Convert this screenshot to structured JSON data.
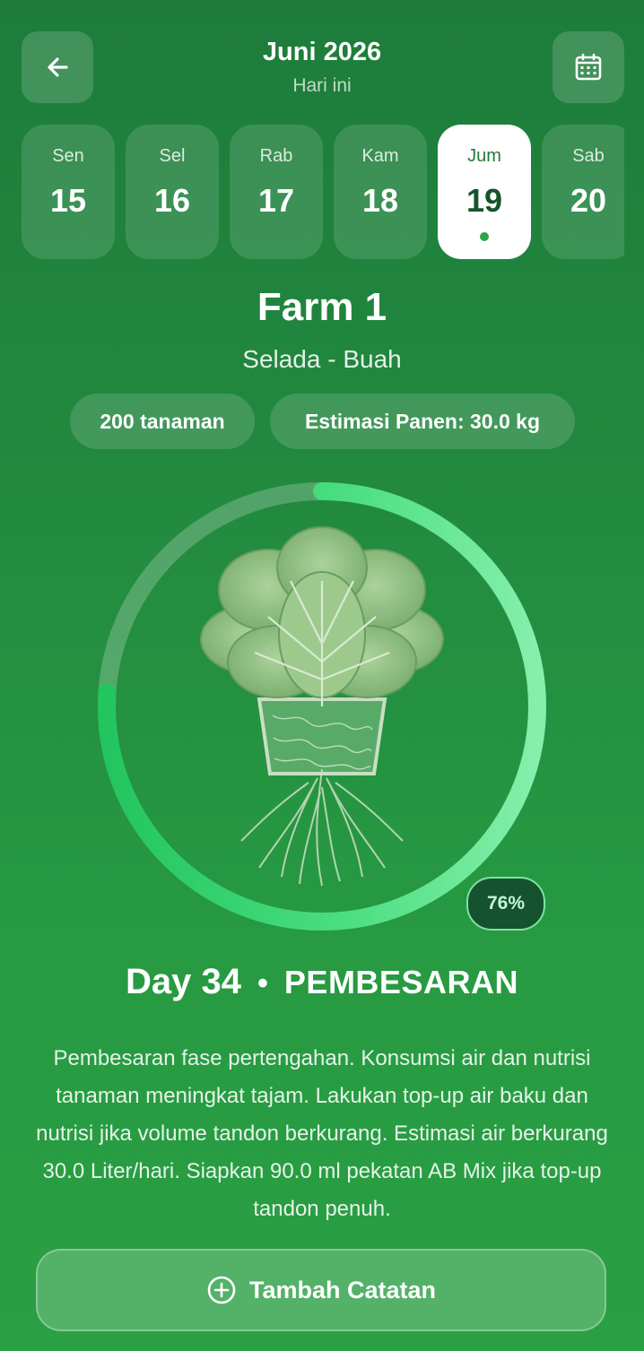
{
  "header": {
    "back_icon": "arrow-left-icon",
    "title": "Juni 2026",
    "subtitle": "Hari ini",
    "calendar_icon": "calendar-icon"
  },
  "days": [
    {
      "name": "Sen",
      "number": "15",
      "active": false
    },
    {
      "name": "Sel",
      "number": "16",
      "active": false
    },
    {
      "name": "Rab",
      "number": "17",
      "active": false
    },
    {
      "name": "Kam",
      "number": "18",
      "active": false
    },
    {
      "name": "Jum",
      "number": "19",
      "active": true
    },
    {
      "name": "Sab",
      "number": "20",
      "active": false
    }
  ],
  "farm": {
    "name": "Farm 1",
    "crop": "Selada - Buah",
    "plants": "200 tanaman",
    "harvest_estimate": "Estimasi Panen: 30.0 kg"
  },
  "progress": {
    "percent_label": "76%",
    "value": 0.76,
    "illustration": "lettuce-plant-with-roots"
  },
  "stage": {
    "day": "Day 34",
    "separator": "•",
    "phase": "PEMBESARAN",
    "description": "Pembesaran fase pertengahan. Konsumsi air dan nutrisi tanaman meningkat tajam. Lakukan top-up air baku dan nutrisi jika volume tandon berkurang. Estimasi air berkurang 30.0 Liter/hari. Siapkan 90.0 ml pekatan AB Mix jika top-up tandon penuh."
  },
  "actions": {
    "add_note_icon": "plus-circle-icon",
    "add_note": "Tambah Catatan"
  },
  "colors": {
    "background": "#22893f",
    "ring_start": "#22c55e",
    "ring_end": "#86efac",
    "badge_bg": "#14532d"
  }
}
